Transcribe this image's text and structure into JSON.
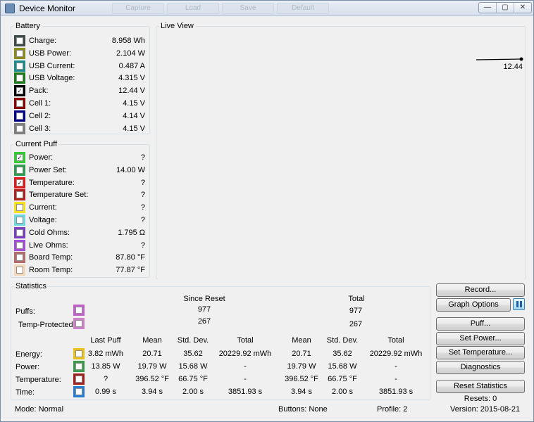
{
  "window": {
    "title": "Device Monitor",
    "ghost_tabs": [
      "Capture",
      "Load",
      "Save",
      "Default"
    ],
    "controls": [
      "—",
      "▢",
      "✕"
    ]
  },
  "battery": {
    "legend": "Battery",
    "rows": [
      {
        "label": "Charge:",
        "value": "8.958 Wh",
        "color": "#3f4a4a",
        "checked": false
      },
      {
        "label": "USB Power:",
        "value": "2.104 W",
        "color": "#8b8b1a",
        "checked": false
      },
      {
        "label": "USB Current:",
        "value": "0.487 A",
        "color": "#1a8b8b",
        "checked": false
      },
      {
        "label": "USB Voltage:",
        "value": "4.315 V",
        "color": "#1a7a1a",
        "checked": false
      },
      {
        "label": "Pack:",
        "value": "12.44 V",
        "color": "#000000",
        "checked": true
      },
      {
        "label": "Cell 1:",
        "value": "4.15 V",
        "color": "#8b0000",
        "checked": false
      },
      {
        "label": "Cell 2:",
        "value": "4.14 V",
        "color": "#00008b",
        "checked": false
      },
      {
        "label": "Cell 3:",
        "value": "4.15 V",
        "color": "#7f7f7f",
        "checked": false
      }
    ]
  },
  "puff": {
    "legend": "Current Puff",
    "rows": [
      {
        "label": "Power:",
        "value": "?",
        "color": "#2ecc2e",
        "checked": true
      },
      {
        "label": "Power Set:",
        "value": "14.00 W",
        "color": "#2e9c4e",
        "checked": false
      },
      {
        "label": "Temperature:",
        "value": "?",
        "color": "#e01a1a",
        "checked": true
      },
      {
        "label": "Temperature Set:",
        "value": "?",
        "color": "#b02222",
        "checked": false
      },
      {
        "label": "Current:",
        "value": "?",
        "color": "#f5e11a",
        "checked": false
      },
      {
        "label": "Voltage:",
        "value": "?",
        "color": "#6fd8e0",
        "checked": false
      },
      {
        "label": "Cold Ohms:",
        "value": "1.795 Ω",
        "color": "#7a3fc0",
        "checked": false
      },
      {
        "label": "Live Ohms:",
        "value": "?",
        "color": "#a24fd8",
        "checked": false
      },
      {
        "label": "Board Temp:",
        "value": "87.80 °F",
        "color": "#b56a6a",
        "checked": false
      },
      {
        "label": "Room Temp:",
        "value": "77.87 °F",
        "color": "#f3d9b8",
        "checked": false
      }
    ]
  },
  "live": {
    "legend": "Live View",
    "trace_value": "12.44",
    "trace_level": 0.75
  },
  "buttons": {
    "record": "Record...",
    "graph_options": "Graph Options",
    "puff": "Puff...",
    "set_power": "Set Power...",
    "set_temperature": "Set Temperature...",
    "diagnostics": "Diagnostics",
    "reset_statistics": "Reset Statistics",
    "resets": "Resets: 0"
  },
  "statistics": {
    "legend": "Statistics",
    "since_reset": "Since Reset",
    "total": "Total",
    "puffs_label": "Puffs:",
    "puffs_color": "#c060c8",
    "puffs_since": "977",
    "puffs_total": "977",
    "temp_label": "Temp-Protected:",
    "temp_color": "#d080c8",
    "temp_since": "267",
    "temp_total": "267",
    "headers": [
      "Last Puff",
      "Mean",
      "Std. Dev.",
      "Total",
      "Mean",
      "Std. Dev.",
      "Total"
    ],
    "rows": [
      {
        "label": "Energy:",
        "color": "#e8c020",
        "cells": [
          "3.82 mWh",
          "20.71",
          "35.62",
          "20229.92 mWh",
          "20.71",
          "35.62",
          "20229.92 mWh"
        ]
      },
      {
        "label": "Power:",
        "color": "#3a9a4a",
        "cells": [
          "13.85 W",
          "19.79 W",
          "15.68 W",
          "-",
          "19.79 W",
          "15.68 W",
          "-"
        ]
      },
      {
        "label": "Temperature:",
        "color": "#a02020",
        "cells": [
          "?",
          "396.52 °F",
          "66.75 °F",
          "-",
          "396.52 °F",
          "66.75 °F",
          "-"
        ]
      },
      {
        "label": "Time:",
        "color": "#2a7ad0",
        "cells": [
          "0.99 s",
          "3.94 s",
          "2.00 s",
          "3851.93 s",
          "3.94 s",
          "2.00 s",
          "3851.93 s"
        ]
      }
    ]
  },
  "status": {
    "mode": "Mode: Normal",
    "buttons": "Buttons: None",
    "profile": "Profile: 2",
    "version": "Version: 2015-08-21"
  }
}
